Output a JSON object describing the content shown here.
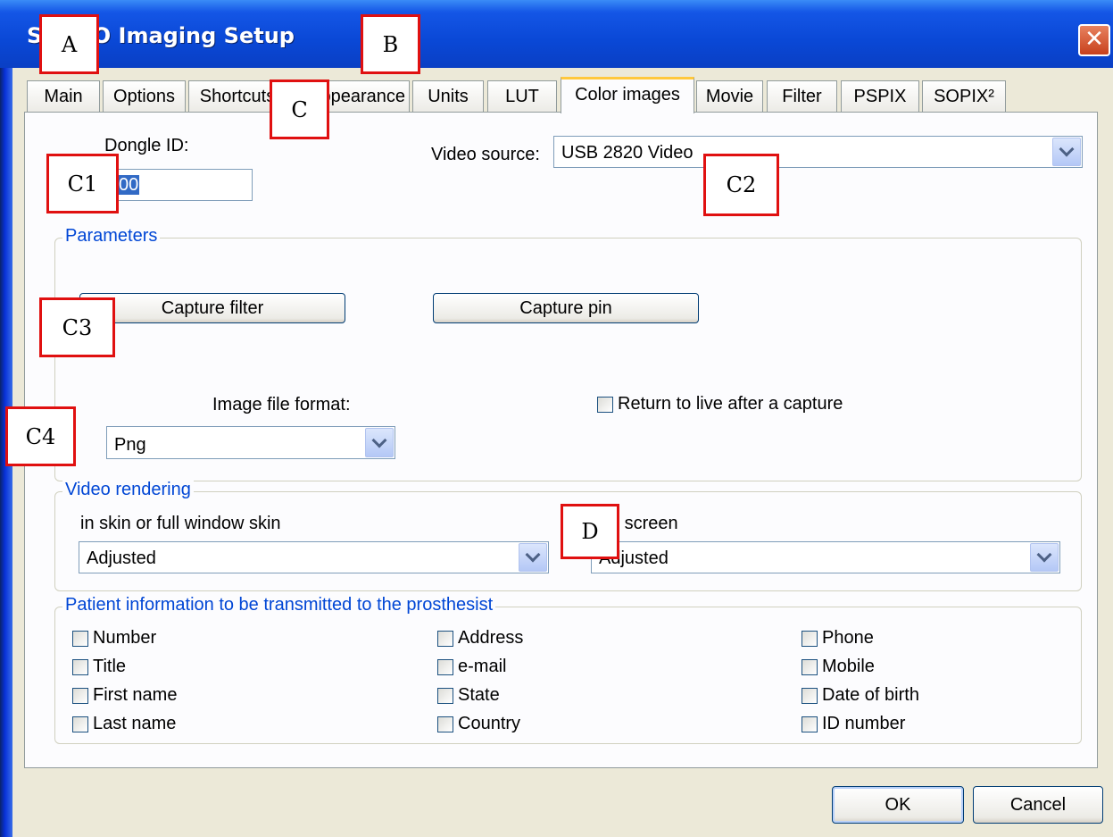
{
  "window": {
    "title": "SOPRO Imaging Setup"
  },
  "tabs": [
    {
      "label": "Main"
    },
    {
      "label": "Options"
    },
    {
      "label": "Shortcuts"
    },
    {
      "label": "Appearance"
    },
    {
      "label": "Units"
    },
    {
      "label": "LUT"
    },
    {
      "label": "Color images",
      "active": true
    },
    {
      "label": "Movie"
    },
    {
      "label": "Filter"
    },
    {
      "label": "PSPIX"
    },
    {
      "label": "SOPIX²"
    }
  ],
  "dongle": {
    "label": "Dongle ID:",
    "value": "00"
  },
  "video_source": {
    "label": "Video source:",
    "value": "USB 2820 Video"
  },
  "parameters": {
    "legend": "Parameters",
    "capture_filter_label": "Capture filter",
    "capture_pin_label": "Capture pin",
    "image_format_label": "Image file format:",
    "image_format_value": "Png",
    "return_live_label": "Return to live after a capture",
    "return_live_checked": false
  },
  "video_rendering": {
    "legend": "Video rendering",
    "skin_label": "in skin or full window skin",
    "skin_value": "Adjusted",
    "fullscreen_label": "ull screen",
    "fullscreen_value": "Adjusted"
  },
  "patient_info": {
    "legend": "Patient information to be transmitted to the prosthesist",
    "items": [
      {
        "label": "Number",
        "checked": false
      },
      {
        "label": "Title",
        "checked": false
      },
      {
        "label": "First name",
        "checked": false
      },
      {
        "label": "Last name",
        "checked": false
      },
      {
        "label": "Address",
        "checked": false
      },
      {
        "label": "e-mail",
        "checked": false
      },
      {
        "label": "State",
        "checked": false
      },
      {
        "label": "Country",
        "checked": false
      },
      {
        "label": "Phone",
        "checked": false
      },
      {
        "label": "Mobile",
        "checked": false
      },
      {
        "label": "Date of birth",
        "checked": false
      },
      {
        "label": "ID number",
        "checked": false
      }
    ]
  },
  "footer": {
    "ok_label": "OK",
    "cancel_label": "Cancel"
  },
  "annotations": [
    "A",
    "B",
    "C",
    "C1",
    "C2",
    "C3",
    "C4",
    "D"
  ],
  "colors": {
    "title_bar": "#0a48d6",
    "close_button": "#c8401c",
    "active_tab_accent": "#ffc83c",
    "group_legend": "#0046d5",
    "annotation_border": "#e01010"
  }
}
